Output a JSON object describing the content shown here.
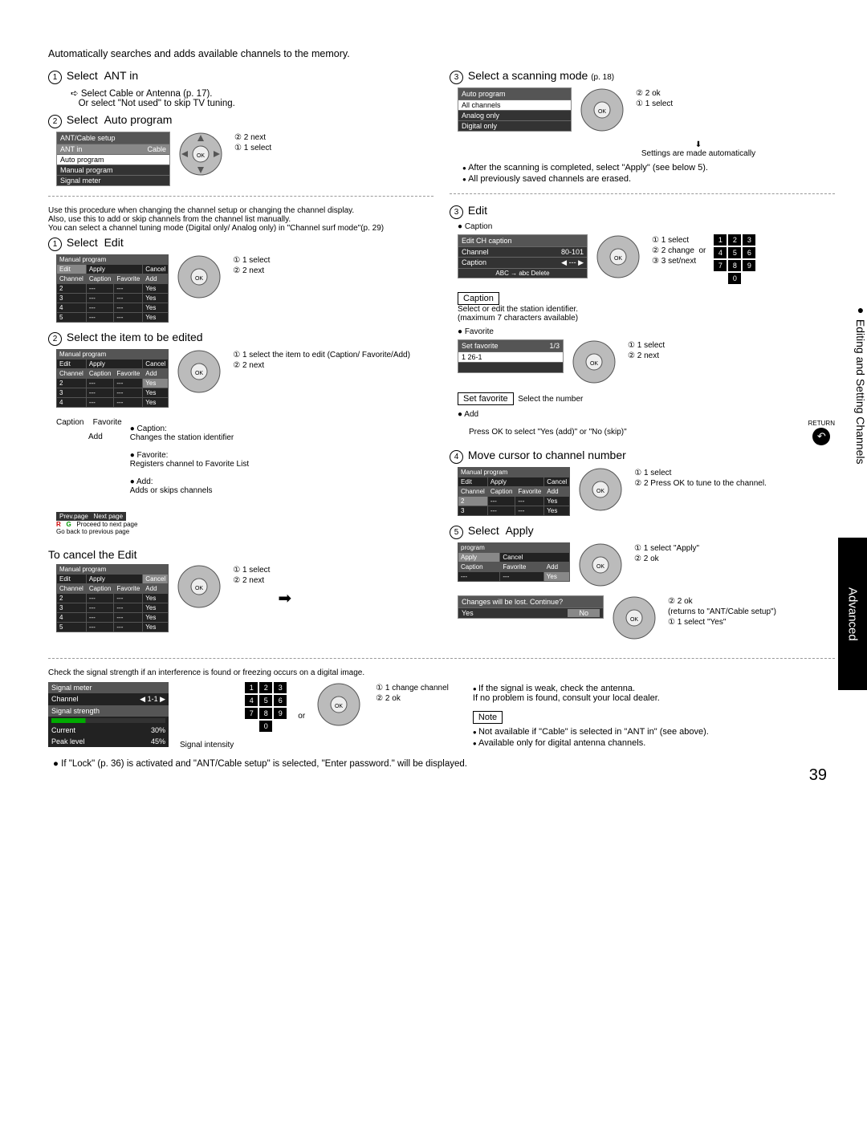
{
  "side_tab": {
    "section": "Editing and Setting Channels",
    "category": "Advanced"
  },
  "page_number": "39",
  "intro": "Automatically searches and adds available channels to the memory.",
  "left": {
    "step1": {
      "num": "1",
      "label": "Select",
      "opt": "ANT in",
      "sub1": "Select Cable or Antenna (p. 17).",
      "sub2": "Or select \"Not used\" to skip TV tuning."
    },
    "step2": {
      "num": "2",
      "label": "Select",
      "opt": "Auto program"
    },
    "ant_menu": {
      "title": "ANT/Cable setup",
      "rows": [
        "ANT in",
        "Auto program",
        "Manual program",
        "Signal meter"
      ],
      "value": "Cable"
    },
    "step2_annot": {
      "a": "2 next",
      "b": "1 select"
    },
    "manual_intro": [
      "Use this procedure when changing the channel setup or changing the channel display.",
      "Also, use this to add or skip channels from the channel list manually.",
      "You can select a channel tuning mode (Digital only/ Analog only) in \"Channel surf mode\"(p. 29)"
    ],
    "mstep1": {
      "num": "1",
      "label": "Select",
      "opt": "Edit"
    },
    "mstep1_annot": {
      "a": "1 select",
      "b": "2 next"
    },
    "mstep2": {
      "num": "2",
      "label": "Select the item to be edited"
    },
    "mstep2_annot": {
      "a": "1 select the item to edit (Caption/ Favorite/Add)",
      "b": "2 next"
    },
    "mtable": {
      "title": "Manual program",
      "btns": [
        "Edit",
        "Apply",
        "Cancel"
      ],
      "headers": [
        "Channel",
        "Caption",
        "Favorite",
        "Add"
      ],
      "rows": [
        [
          "2",
          "---",
          "---",
          "Yes"
        ],
        [
          "3",
          "---",
          "---",
          "Yes"
        ],
        [
          "4",
          "---",
          "---",
          "Yes"
        ],
        [
          "5",
          "---",
          "---",
          "Yes"
        ]
      ]
    },
    "labels": {
      "caption": "Caption",
      "favorite": "Favorite",
      "add": "Add"
    },
    "defs": {
      "caption": "Caption:\nChanges the station identifier",
      "favorite": "Favorite:\nRegisters channel to Favorite List",
      "add": "Add:\nAdds or skips channels"
    },
    "nav": {
      "prev": "Prev.page",
      "next": "Next page",
      "r": "R",
      "g": "G",
      "goback": "Go back to previous page",
      "proceed": "Proceed to next page"
    },
    "cancel": {
      "title": "To cancel the Edit",
      "annot": {
        "a": "1 select",
        "b": "2 next"
      }
    }
  },
  "right": {
    "step3": {
      "num": "3",
      "label": "Select a scanning mode",
      "pg": "(p. 18)"
    },
    "auto_menu": {
      "title": "Auto program",
      "rows": [
        "All channels",
        "Analog only",
        "Digital only"
      ]
    },
    "step3_annot": {
      "a": "2 ok",
      "b": "1 select"
    },
    "auto_notes": {
      "setauto": "Settings are made automatically",
      "b1": "After the scanning is completed, select \"Apply\" (see below 5).",
      "b2": "All previously saved channels are erased."
    },
    "edit3": {
      "num": "3",
      "label": "Edit"
    },
    "caption_txt": "Caption",
    "editch": {
      "title": "Edit CH caption",
      "ch_label": "Channel",
      "ch_val": "80-101",
      "cap_label": "Caption",
      "cap_val": "---",
      "hint": "ABC → abc     Delete"
    },
    "edit3_annot": {
      "a": "1 select",
      "b": "2 change",
      "or": "or",
      "c": "3 set/next"
    },
    "caption_label": "Caption",
    "caption_desc": "Select or edit the station identifier.",
    "caption_desc2": "(maximum 7 characters available)",
    "favorite_txt": "Favorite",
    "setfav": {
      "title": "Set favorite",
      "page": "1/3",
      "row": "1   26-1"
    },
    "fav_annot": {
      "a": "1 select",
      "b": "2 next"
    },
    "setfav_label": "Set favorite",
    "setfav_desc": "Select the number",
    "add_txt": "Add",
    "add_desc": "Press OK to select \"Yes (add)\" or \"No (skip)\"",
    "return_label": "RETURN",
    "step4": {
      "num": "4",
      "label": "Move cursor to channel number"
    },
    "step4_annot": {
      "a": "1 select",
      "b": "2 Press OK to tune to the channel."
    },
    "step5": {
      "num": "5",
      "label": "Select",
      "opt": "Apply"
    },
    "step5_menu": {
      "title": "program",
      "btns": [
        "Apply",
        "Cancel"
      ],
      "row": [
        "Caption",
        "Favorite",
        "Add"
      ],
      "vals": [
        "---",
        "---",
        "Yes"
      ]
    },
    "step5_annot": {
      "a": "1 select \"Apply\"",
      "b": "2 ok"
    },
    "cancel_dialog": {
      "msg": "Changes will be lost. Continue?",
      "yes": "Yes",
      "no": "No"
    },
    "cancel_annot": {
      "top": "2 ok",
      "mid": "(returns to \"ANT/Cable setup\")",
      "bot": "1 select \"Yes\""
    }
  },
  "signal": {
    "intro": "Check the signal strength if an interference is found or freezing occurs on a digital image.",
    "meter": {
      "title": "Signal  meter",
      "ch_label": "Channel",
      "ch_val": "1-1",
      "strength": "Signal  strength",
      "cur_label": "Current",
      "cur_val": "30%",
      "peak_label": "Peak level",
      "peak_val": "45%"
    },
    "intensity": "Signal intensity",
    "or": "or",
    "annot": {
      "a": "1 change channel",
      "b": "2 ok"
    },
    "r_bullets": [
      "If the signal is weak, check the antenna.\nIf no problem is found, consult your local dealer."
    ],
    "note": "Note",
    "notes": [
      "Not available if \"Cable\" is selected in \"ANT in\" (see above).",
      "Available only for digital antenna channels."
    ]
  },
  "lock_note": "If \"Lock\" (p. 36) is activated and \"ANT/Cable setup\" is selected, \"Enter password.\" will be displayed."
}
